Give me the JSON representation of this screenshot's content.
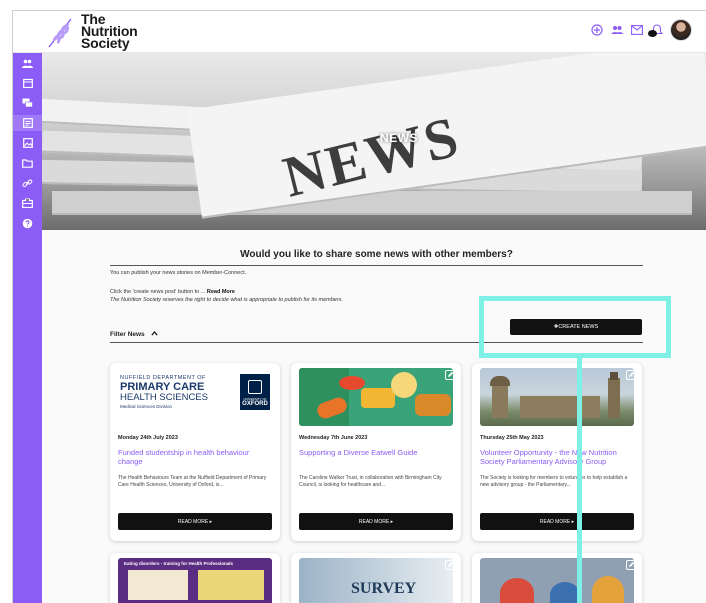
{
  "brand": {
    "line1": "The",
    "line2": "Nutrition",
    "line3": "Society"
  },
  "hero": {
    "title": "NEWS",
    "word": "NEWS"
  },
  "share": {
    "title": "Would you like to share some news with other members?",
    "line1": "You can publish your news stories on Member-Connect.",
    "line2_prefix": "Click the 'create news post' button to ... ",
    "line2_link": "Read More",
    "line3": "The Nutrition Society reserves the right to decide what is appropriate to publish for its members."
  },
  "filter": {
    "label": "Filter News"
  },
  "create_button": "✚CREATE NEWS",
  "cards": [
    {
      "date": "Monday 24th July 2023",
      "title": "Funded studentship in health behaviour change",
      "excerpt": "The Health Behaviours Team at the Nuffield Department of Primary Care Health Sciences, University of Oxford, is...",
      "button": "READ MORE ▸",
      "img_lines": [
        "NUFFIELD DEPARTMENT OF",
        "PRIMARY CARE",
        "HEALTH SCIENCES",
        "Medical Sciences Division"
      ],
      "img_badge": "OXFORD",
      "img_badge_small": "UNIVERSITY OF"
    },
    {
      "date": "Wednesday 7th June 2023",
      "title": "Supporting a Diverse Eatwell Guide",
      "excerpt": "The Caroline Walker Trust, in collaboration with Birmingham City Council, is looking for healthcare and...",
      "button": "READ MORE ▸"
    },
    {
      "date": "Thursday 25th May 2023",
      "title": "Volunteer Opportunity - the New Nutrition Society Parliamentary Advisory Group",
      "excerpt": "The Society is looking for members to volunteer to help establish a new advisory group - the Parliamentary...",
      "button": "READ MORE ▸"
    }
  ],
  "row2": [
    {
      "img_text": "Eating disorders - training for Health Professionals"
    },
    {
      "img_text": "SURVEY"
    },
    {
      "img_text": ""
    }
  ],
  "colors": {
    "accent": "#8b5cf6",
    "highlight": "#7ff0e6",
    "button": "#111111"
  }
}
